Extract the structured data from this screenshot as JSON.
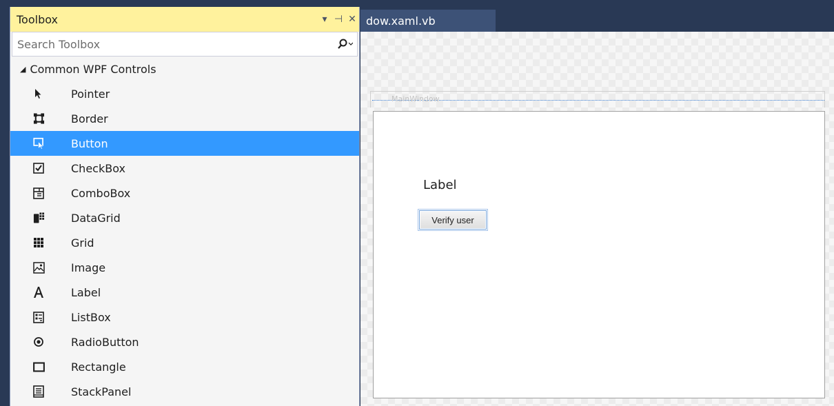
{
  "toolbox": {
    "title": "Toolbox",
    "dropdown_glyph": "▾",
    "pin_glyph": "⊣",
    "close_glyph": "✕",
    "search_placeholder": "Search Toolbox",
    "group": "Common WPF Controls",
    "selected_index": 2,
    "items": [
      {
        "label": "Pointer",
        "icon": "pointer-icon"
      },
      {
        "label": "Border",
        "icon": "border-icon"
      },
      {
        "label": "Button",
        "icon": "button-icon"
      },
      {
        "label": "CheckBox",
        "icon": "checkbox-icon"
      },
      {
        "label": "ComboBox",
        "icon": "combobox-icon"
      },
      {
        "label": "DataGrid",
        "icon": "datagrid-icon"
      },
      {
        "label": "Grid",
        "icon": "grid-icon"
      },
      {
        "label": "Image",
        "icon": "image-icon"
      },
      {
        "label": "Label",
        "icon": "label-icon"
      },
      {
        "label": "ListBox",
        "icon": "listbox-icon"
      },
      {
        "label": "RadioButton",
        "icon": "radiobutton-icon"
      },
      {
        "label": "Rectangle",
        "icon": "rectangle-icon"
      },
      {
        "label": "StackPanel",
        "icon": "stackpanel-icon"
      }
    ]
  },
  "editor": {
    "tab_label": "dow.xaml.vb",
    "window_title": "MainWindow",
    "label_text": "Label",
    "button_text": "Verify user"
  },
  "colors": {
    "chrome": "#293955",
    "toolbox_header": "#fff29d",
    "selection": "#3399ff"
  }
}
